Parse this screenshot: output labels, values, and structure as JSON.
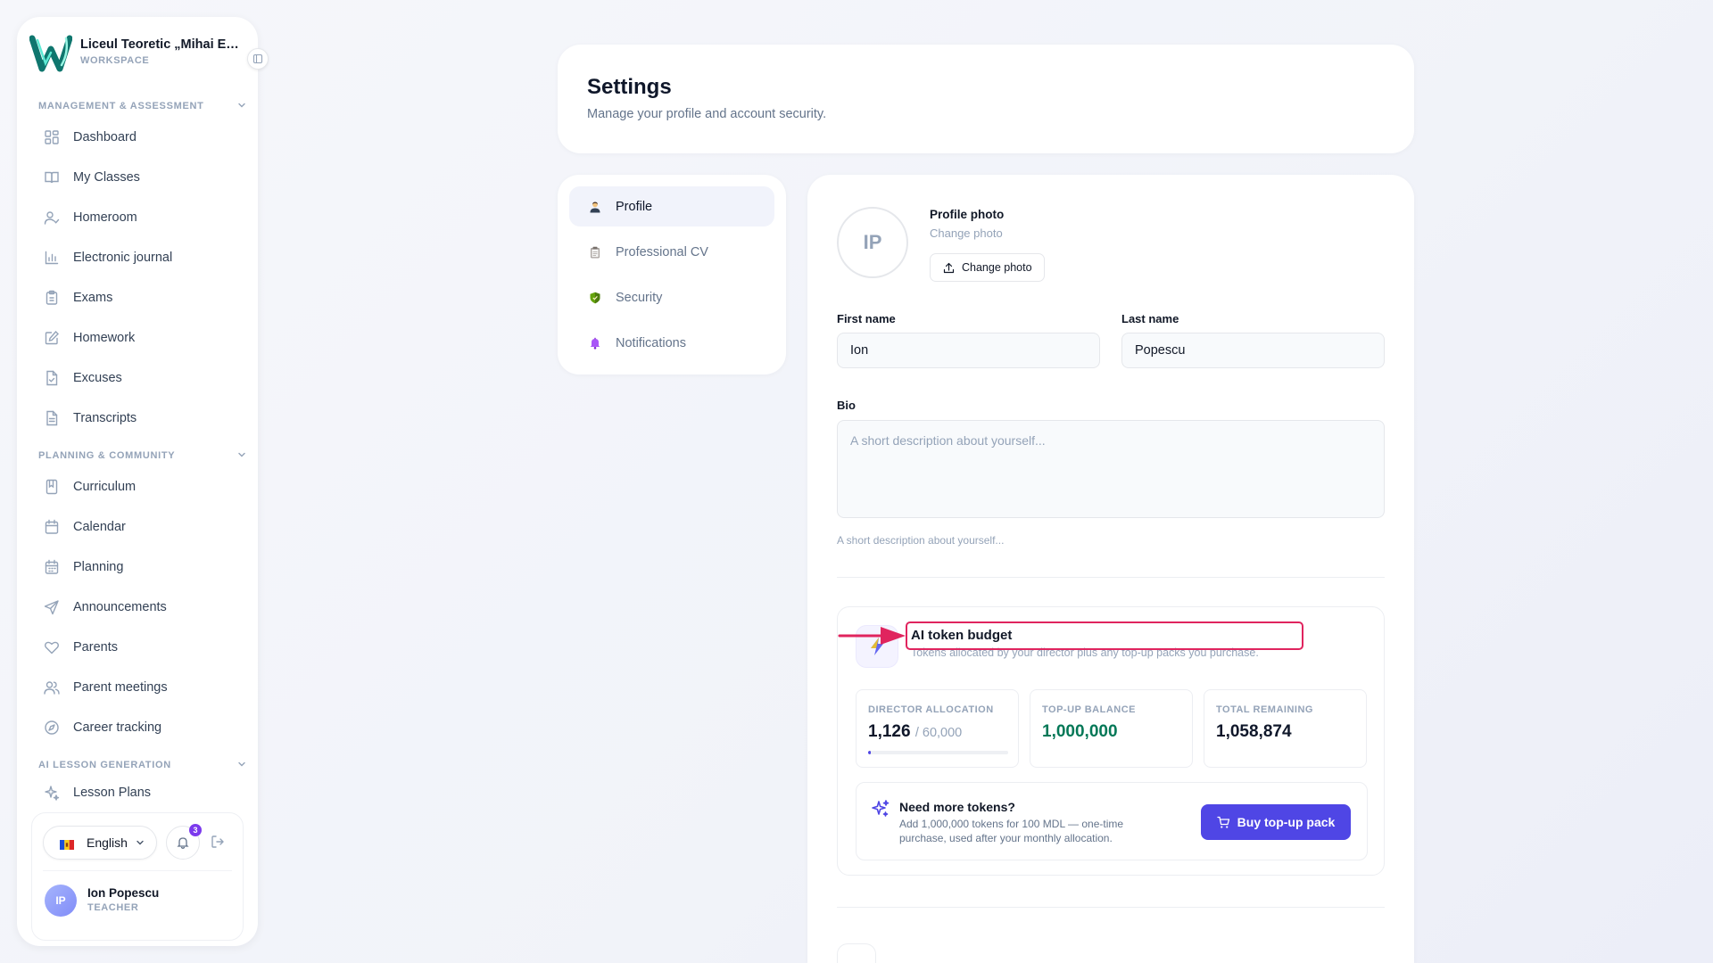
{
  "workspace": {
    "name": "Liceul Teoretic „Mihai Eminescu”",
    "subtitle": "WORKSPACE"
  },
  "sidebar": {
    "sections": [
      {
        "title": "MANAGEMENT & ASSESSMENT"
      },
      {
        "title": "PLANNING & COMMUNITY"
      },
      {
        "title": "AI LESSON GENERATION"
      }
    ],
    "items": [
      {
        "label": "Dashboard",
        "icon": "grid-icon"
      },
      {
        "label": "My Classes",
        "icon": "book-open-icon"
      },
      {
        "label": "Homeroom",
        "icon": "user-check-icon"
      },
      {
        "label": "Electronic journal",
        "icon": "bar-chart-icon"
      },
      {
        "label": "Exams",
        "icon": "clipboard-icon"
      },
      {
        "label": "Homework",
        "icon": "edit-icon"
      },
      {
        "label": "Excuses",
        "icon": "file-check-icon"
      },
      {
        "label": "Transcripts",
        "icon": "file-text-icon"
      },
      {
        "label": "Curriculum",
        "icon": "book-icon"
      },
      {
        "label": "Calendar",
        "icon": "calendar-icon"
      },
      {
        "label": "Planning",
        "icon": "calendar-grid-icon"
      },
      {
        "label": "Announcements",
        "icon": "send-icon"
      },
      {
        "label": "Parents",
        "icon": "heart-icon"
      },
      {
        "label": "Parent meetings",
        "icon": "users-icon"
      },
      {
        "label": "Career tracking",
        "icon": "compass-icon"
      },
      {
        "label": "Lesson Plans",
        "icon": "sparkles-icon"
      }
    ]
  },
  "footer": {
    "language": "English",
    "notifications_count": "3",
    "user": {
      "initials": "IP",
      "name": "Ion Popescu",
      "role": "TEACHER"
    }
  },
  "header": {
    "title": "Settings",
    "subtitle": "Manage your profile and account security."
  },
  "tabs": [
    {
      "label": "Profile",
      "active": true
    },
    {
      "label": "Professional CV",
      "active": false
    },
    {
      "label": "Security",
      "active": false
    },
    {
      "label": "Notifications",
      "active": false
    }
  ],
  "profile": {
    "initials": "IP",
    "photo_title": "Profile photo",
    "photo_sub": "Change photo",
    "photo_button": "Change photo",
    "first_name_label": "First name",
    "first_name": "Ion",
    "last_name_label": "Last name",
    "last_name": "Popescu",
    "bio_label": "Bio",
    "bio_placeholder": "A short description about yourself...",
    "bio_hint": "A short description about yourself..."
  },
  "token_budget": {
    "title": "AI token budget",
    "subtitle": "Tokens allocated by your director plus any top-up packs you purchase.",
    "director_allocation": {
      "label": "DIRECTOR ALLOCATION",
      "value": "1,126",
      "max": "/ 60,000",
      "fraction": 0.019
    },
    "topup_balance": {
      "label": "TOP-UP BALANCE",
      "value": "1,000,000"
    },
    "total_remaining": {
      "label": "TOTAL REMAINING",
      "value": "1,058,874"
    },
    "need_more": {
      "title": "Need more tokens?",
      "description": "Add 1,000,000 tokens for 100 MDL — one-time purchase, used after your monthly allocation.",
      "button": "Buy top-up pack"
    }
  },
  "colors": {
    "accent": "#4f46e5",
    "annotation": "#e0245e",
    "positive": "#047857"
  }
}
